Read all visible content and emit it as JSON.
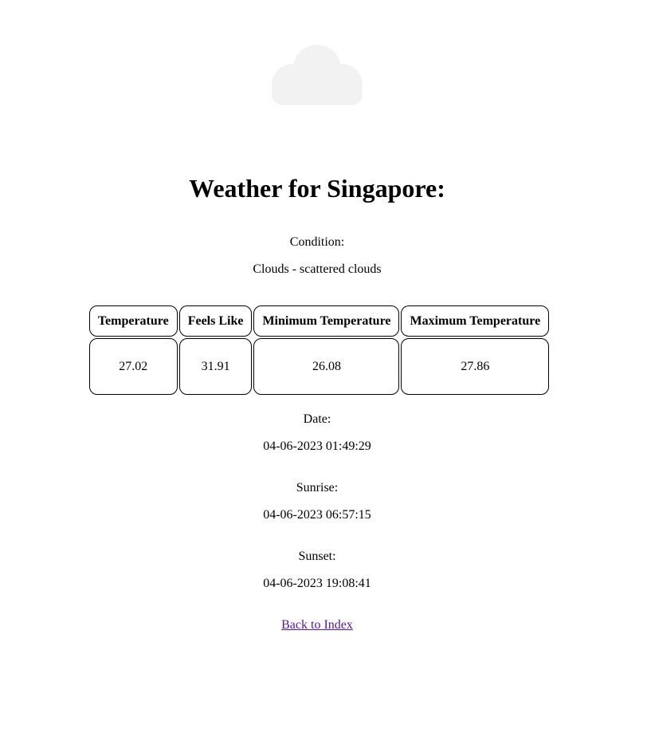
{
  "icon": "cloud-icon",
  "colors": {
    "cloud": "#f2f2f2",
    "link": "#551a8b"
  },
  "title": "Weather for Singapore:",
  "condition": {
    "label": "Condition:",
    "value": "Clouds - scattered clouds"
  },
  "table": {
    "headers": [
      "Temperature",
      "Feels Like",
      "Minimum Temperature",
      "Maximum Temperature"
    ],
    "values": [
      "27.02",
      "31.91",
      "26.08",
      "27.86"
    ]
  },
  "date": {
    "label": "Date:",
    "value": "04-06-2023 01:49:29"
  },
  "sunrise": {
    "label": "Sunrise:",
    "value": "04-06-2023 06:57:15"
  },
  "sunset": {
    "label": "Sunset:",
    "value": "04-06-2023 19:08:41"
  },
  "back_link": "Back to Index"
}
